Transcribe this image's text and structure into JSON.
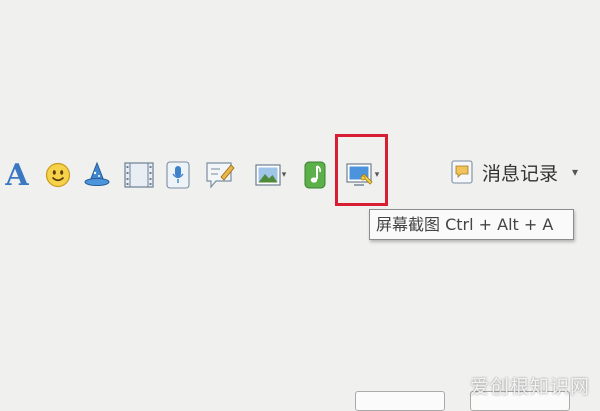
{
  "toolbar": {
    "font_glyph": "A",
    "icons": [
      "font-icon",
      "emoji-icon",
      "magic-hat-icon",
      "film-strip-icon",
      "microphone-icon",
      "note-icon",
      "image-icon",
      "music-icon",
      "screenshot-icon"
    ],
    "dropdown_glyph": "▾"
  },
  "history": {
    "label": "消息记录",
    "caret": "▾"
  },
  "tooltip": {
    "text": "屏幕截图 Ctrl + Alt + A"
  },
  "watermark": {
    "text": "爱创根知识网"
  },
  "colors": {
    "highlight": "#d81e33",
    "accent_blue": "#3a78c2",
    "background": "#f0f0ef"
  }
}
